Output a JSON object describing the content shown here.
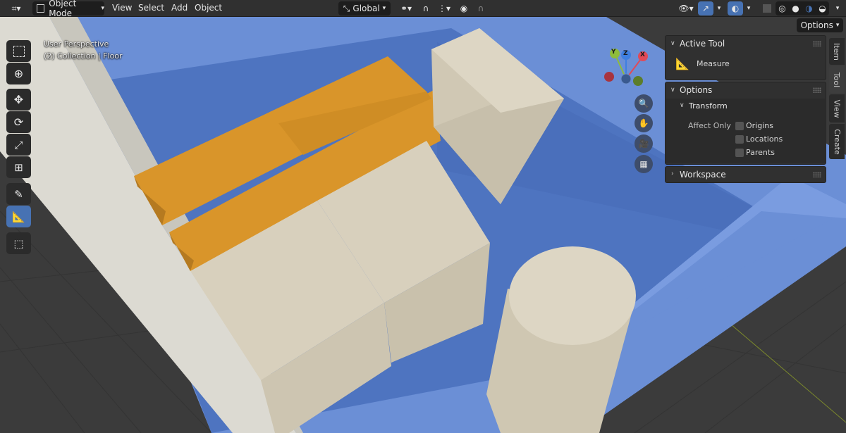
{
  "header": {
    "mode_label": "Object Mode",
    "menus": [
      "View",
      "Select",
      "Add",
      "Object"
    ],
    "orientation_label": "Global",
    "options_label": "Options"
  },
  "viewport": {
    "perspective_label": "User Perspective",
    "collection_label": "(2) Collection | Floor"
  },
  "gizmo": {
    "axis_x": "X",
    "axis_y": "Y",
    "axis_z": "Z"
  },
  "sidebar": {
    "active_tool_title": "Active Tool",
    "tool_name": "Measure",
    "options_title": "Options",
    "transform_title": "Transform",
    "affect_only_label": "Affect Only",
    "checkboxes": [
      {
        "label": "Origins",
        "checked": false
      },
      {
        "label": "Locations",
        "checked": false
      },
      {
        "label": "Parents",
        "checked": false
      }
    ],
    "workspace_title": "Workspace",
    "tabs": [
      "Item",
      "Tool",
      "View",
      "Create"
    ]
  },
  "toolbar": {
    "tools": [
      "select-box",
      "cursor",
      "move",
      "rotate",
      "scale",
      "transform",
      "annotate",
      "measure",
      "add-cube"
    ],
    "active_tool": "measure"
  },
  "colors": {
    "accent": "#4772b3",
    "floor_blue": "#4e74c0",
    "wall_blue": "#6b8fd6",
    "plank_orange": "#d9952a",
    "box_beige": "#d8d0bd"
  }
}
